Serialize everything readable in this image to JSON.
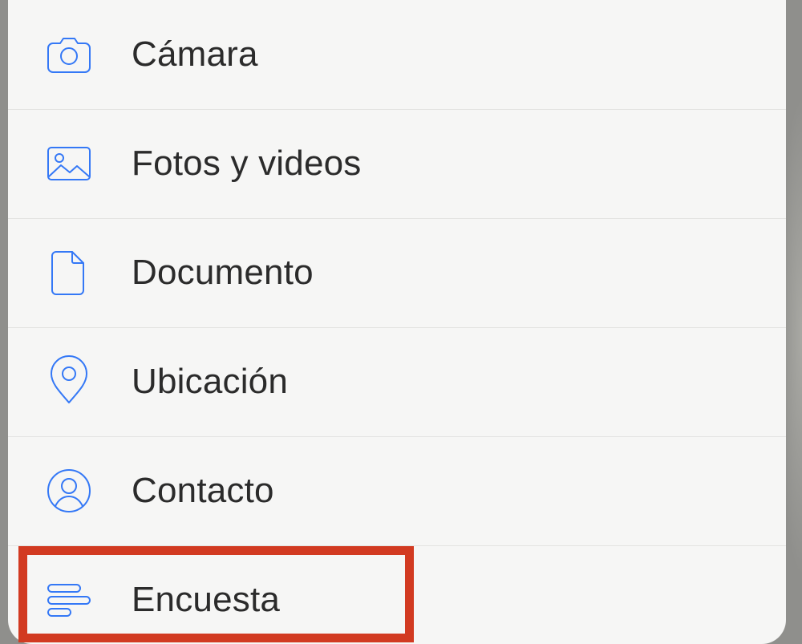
{
  "accent_color": "#3478f6",
  "highlight_color": "#d23a21",
  "menu": {
    "items": [
      {
        "id": "camera",
        "label": "Cámara",
        "icon": "camera-icon"
      },
      {
        "id": "photos-videos",
        "label": "Fotos y videos",
        "icon": "image-icon"
      },
      {
        "id": "document",
        "label": "Documento",
        "icon": "document-icon"
      },
      {
        "id": "location",
        "label": "Ubicación",
        "icon": "location-pin-icon"
      },
      {
        "id": "contact",
        "label": "Contacto",
        "icon": "contact-icon"
      },
      {
        "id": "poll",
        "label": "Encuesta",
        "icon": "poll-icon",
        "highlighted": true
      }
    ]
  }
}
